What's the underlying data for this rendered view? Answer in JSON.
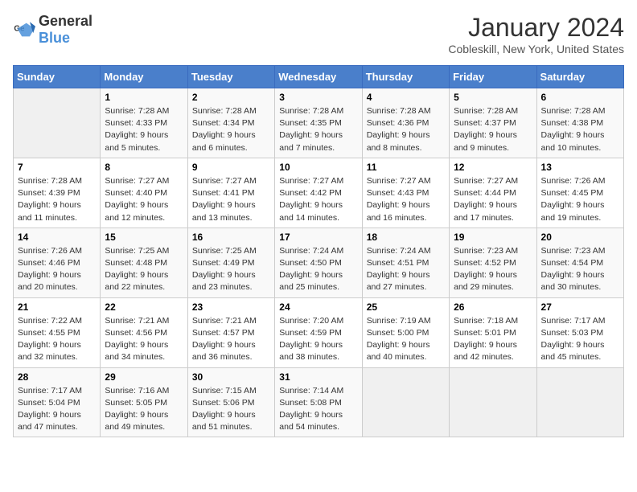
{
  "header": {
    "logo_general": "General",
    "logo_blue": "Blue",
    "month_year": "January 2024",
    "location": "Cobleskill, New York, United States"
  },
  "days_of_week": [
    "Sunday",
    "Monday",
    "Tuesday",
    "Wednesday",
    "Thursday",
    "Friday",
    "Saturday"
  ],
  "weeks": [
    [
      {
        "num": "",
        "empty": true
      },
      {
        "num": "1",
        "sunrise": "Sunrise: 7:28 AM",
        "sunset": "Sunset: 4:33 PM",
        "daylight": "Daylight: 9 hours and 5 minutes."
      },
      {
        "num": "2",
        "sunrise": "Sunrise: 7:28 AM",
        "sunset": "Sunset: 4:34 PM",
        "daylight": "Daylight: 9 hours and 6 minutes."
      },
      {
        "num": "3",
        "sunrise": "Sunrise: 7:28 AM",
        "sunset": "Sunset: 4:35 PM",
        "daylight": "Daylight: 9 hours and 7 minutes."
      },
      {
        "num": "4",
        "sunrise": "Sunrise: 7:28 AM",
        "sunset": "Sunset: 4:36 PM",
        "daylight": "Daylight: 9 hours and 8 minutes."
      },
      {
        "num": "5",
        "sunrise": "Sunrise: 7:28 AM",
        "sunset": "Sunset: 4:37 PM",
        "daylight": "Daylight: 9 hours and 9 minutes."
      },
      {
        "num": "6",
        "sunrise": "Sunrise: 7:28 AM",
        "sunset": "Sunset: 4:38 PM",
        "daylight": "Daylight: 9 hours and 10 minutes."
      }
    ],
    [
      {
        "num": "7",
        "sunrise": "Sunrise: 7:28 AM",
        "sunset": "Sunset: 4:39 PM",
        "daylight": "Daylight: 9 hours and 11 minutes."
      },
      {
        "num": "8",
        "sunrise": "Sunrise: 7:27 AM",
        "sunset": "Sunset: 4:40 PM",
        "daylight": "Daylight: 9 hours and 12 minutes."
      },
      {
        "num": "9",
        "sunrise": "Sunrise: 7:27 AM",
        "sunset": "Sunset: 4:41 PM",
        "daylight": "Daylight: 9 hours and 13 minutes."
      },
      {
        "num": "10",
        "sunrise": "Sunrise: 7:27 AM",
        "sunset": "Sunset: 4:42 PM",
        "daylight": "Daylight: 9 hours and 14 minutes."
      },
      {
        "num": "11",
        "sunrise": "Sunrise: 7:27 AM",
        "sunset": "Sunset: 4:43 PM",
        "daylight": "Daylight: 9 hours and 16 minutes."
      },
      {
        "num": "12",
        "sunrise": "Sunrise: 7:27 AM",
        "sunset": "Sunset: 4:44 PM",
        "daylight": "Daylight: 9 hours and 17 minutes."
      },
      {
        "num": "13",
        "sunrise": "Sunrise: 7:26 AM",
        "sunset": "Sunset: 4:45 PM",
        "daylight": "Daylight: 9 hours and 19 minutes."
      }
    ],
    [
      {
        "num": "14",
        "sunrise": "Sunrise: 7:26 AM",
        "sunset": "Sunset: 4:46 PM",
        "daylight": "Daylight: 9 hours and 20 minutes."
      },
      {
        "num": "15",
        "sunrise": "Sunrise: 7:25 AM",
        "sunset": "Sunset: 4:48 PM",
        "daylight": "Daylight: 9 hours and 22 minutes."
      },
      {
        "num": "16",
        "sunrise": "Sunrise: 7:25 AM",
        "sunset": "Sunset: 4:49 PM",
        "daylight": "Daylight: 9 hours and 23 minutes."
      },
      {
        "num": "17",
        "sunrise": "Sunrise: 7:24 AM",
        "sunset": "Sunset: 4:50 PM",
        "daylight": "Daylight: 9 hours and 25 minutes."
      },
      {
        "num": "18",
        "sunrise": "Sunrise: 7:24 AM",
        "sunset": "Sunset: 4:51 PM",
        "daylight": "Daylight: 9 hours and 27 minutes."
      },
      {
        "num": "19",
        "sunrise": "Sunrise: 7:23 AM",
        "sunset": "Sunset: 4:52 PM",
        "daylight": "Daylight: 9 hours and 29 minutes."
      },
      {
        "num": "20",
        "sunrise": "Sunrise: 7:23 AM",
        "sunset": "Sunset: 4:54 PM",
        "daylight": "Daylight: 9 hours and 30 minutes."
      }
    ],
    [
      {
        "num": "21",
        "sunrise": "Sunrise: 7:22 AM",
        "sunset": "Sunset: 4:55 PM",
        "daylight": "Daylight: 9 hours and 32 minutes."
      },
      {
        "num": "22",
        "sunrise": "Sunrise: 7:21 AM",
        "sunset": "Sunset: 4:56 PM",
        "daylight": "Daylight: 9 hours and 34 minutes."
      },
      {
        "num": "23",
        "sunrise": "Sunrise: 7:21 AM",
        "sunset": "Sunset: 4:57 PM",
        "daylight": "Daylight: 9 hours and 36 minutes."
      },
      {
        "num": "24",
        "sunrise": "Sunrise: 7:20 AM",
        "sunset": "Sunset: 4:59 PM",
        "daylight": "Daylight: 9 hours and 38 minutes."
      },
      {
        "num": "25",
        "sunrise": "Sunrise: 7:19 AM",
        "sunset": "Sunset: 5:00 PM",
        "daylight": "Daylight: 9 hours and 40 minutes."
      },
      {
        "num": "26",
        "sunrise": "Sunrise: 7:18 AM",
        "sunset": "Sunset: 5:01 PM",
        "daylight": "Daylight: 9 hours and 42 minutes."
      },
      {
        "num": "27",
        "sunrise": "Sunrise: 7:17 AM",
        "sunset": "Sunset: 5:03 PM",
        "daylight": "Daylight: 9 hours and 45 minutes."
      }
    ],
    [
      {
        "num": "28",
        "sunrise": "Sunrise: 7:17 AM",
        "sunset": "Sunset: 5:04 PM",
        "daylight": "Daylight: 9 hours and 47 minutes."
      },
      {
        "num": "29",
        "sunrise": "Sunrise: 7:16 AM",
        "sunset": "Sunset: 5:05 PM",
        "daylight": "Daylight: 9 hours and 49 minutes."
      },
      {
        "num": "30",
        "sunrise": "Sunrise: 7:15 AM",
        "sunset": "Sunset: 5:06 PM",
        "daylight": "Daylight: 9 hours and 51 minutes."
      },
      {
        "num": "31",
        "sunrise": "Sunrise: 7:14 AM",
        "sunset": "Sunset: 5:08 PM",
        "daylight": "Daylight: 9 hours and 54 minutes."
      },
      {
        "num": "",
        "empty": true
      },
      {
        "num": "",
        "empty": true
      },
      {
        "num": "",
        "empty": true
      }
    ]
  ]
}
